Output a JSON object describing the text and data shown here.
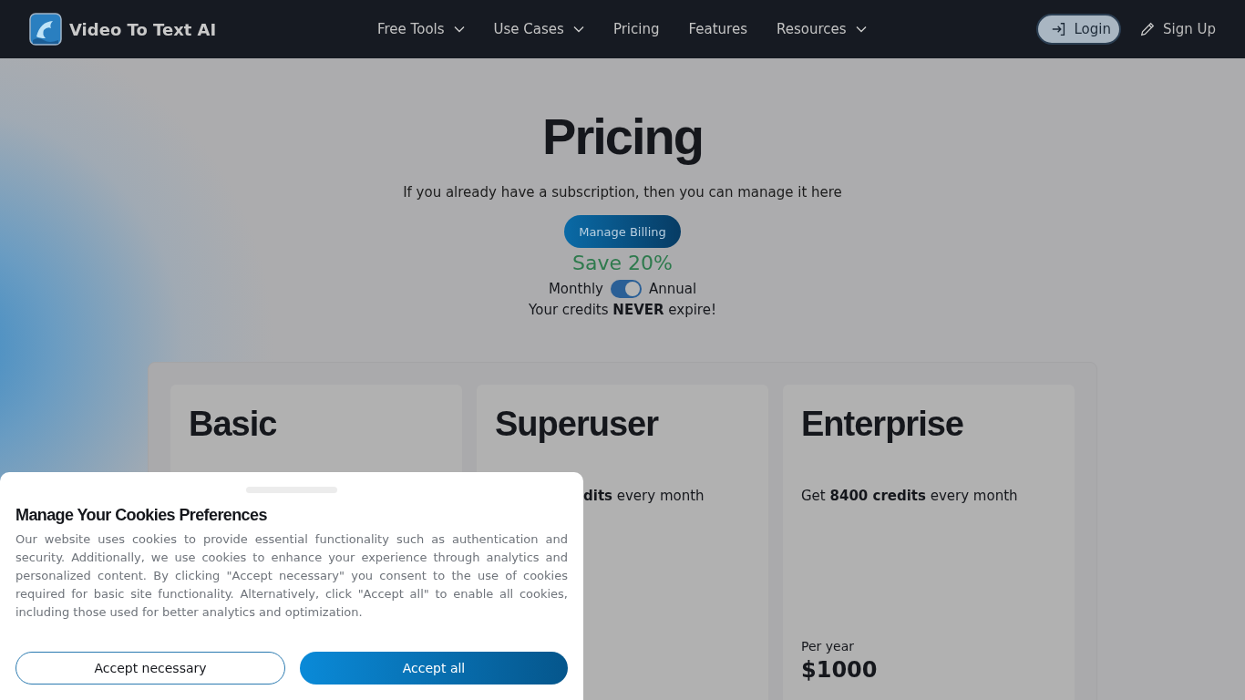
{
  "nav": {
    "brand": "Video To Text AI",
    "links": [
      {
        "label": "Free Tools",
        "dropdown": true
      },
      {
        "label": "Use Cases",
        "dropdown": true
      },
      {
        "label": "Pricing",
        "dropdown": false
      },
      {
        "label": "Features",
        "dropdown": false
      },
      {
        "label": "Resources",
        "dropdown": true
      }
    ],
    "login": "Login",
    "signup": "Sign Up"
  },
  "hero": {
    "title": "Pricing",
    "subtitle": "If you already have a subscription, then you can manage it here",
    "billing_button": "Manage Billing",
    "save": "Save 20%",
    "toggle": {
      "left": "Monthly",
      "right": "Annual",
      "on": true
    },
    "note": "Your credits **NEVER** expire!"
  },
  "plans": [
    {
      "name": "Basic"
    },
    {
      "name": "Superuser",
      "description": "**dits** every month",
      "partly_covered": true
    },
    {
      "name": "Enterprise",
      "description": "Get **8400 credits** every month",
      "period": "Per year",
      "price": "$1000"
    }
  ],
  "cookie_dialog": {
    "title": "Manage Your Cookies Preferences",
    "text": "Our website uses cookies to provide essential functionality such as authentication and security. Additionally, we use cookies to enhance your experience through analytics and personalized content. By clicking \"Accept necessary\" you consent to the use of cookies required for basic site functionality. Alternatively, click \"Accept all\" to enable all cookies, including those used for better analytics and optimization.",
    "buttons": [
      {
        "label": "Accept necessary",
        "kind": "outline"
      },
      {
        "label": "Accept all",
        "kind": "primary"
      }
    ]
  }
}
